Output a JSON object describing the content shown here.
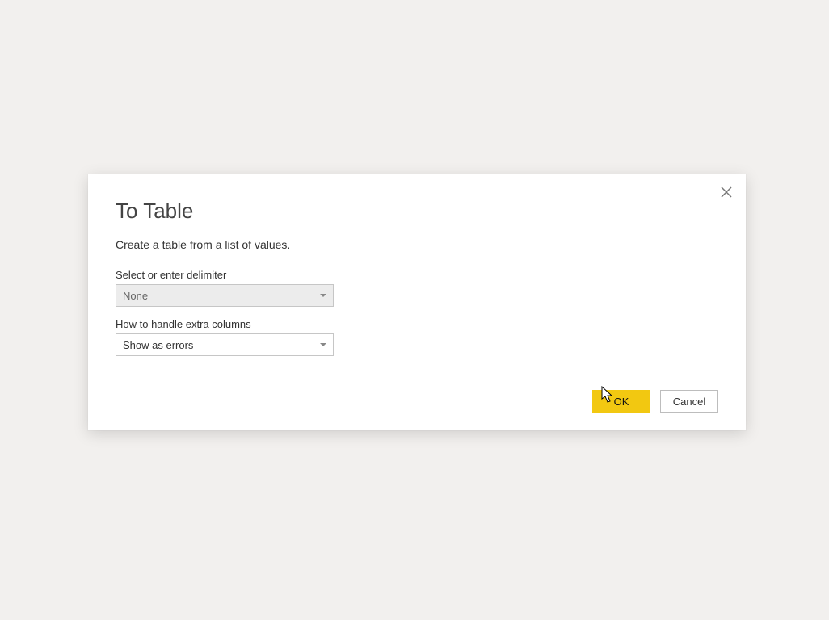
{
  "dialog": {
    "title": "To Table",
    "subtitle": "Create a table from a list of values.",
    "field1": {
      "label": "Select or enter delimiter",
      "value": "None"
    },
    "field2": {
      "label": "How to handle extra columns",
      "value": "Show as errors"
    },
    "buttons": {
      "ok": "OK",
      "cancel": "Cancel"
    }
  }
}
